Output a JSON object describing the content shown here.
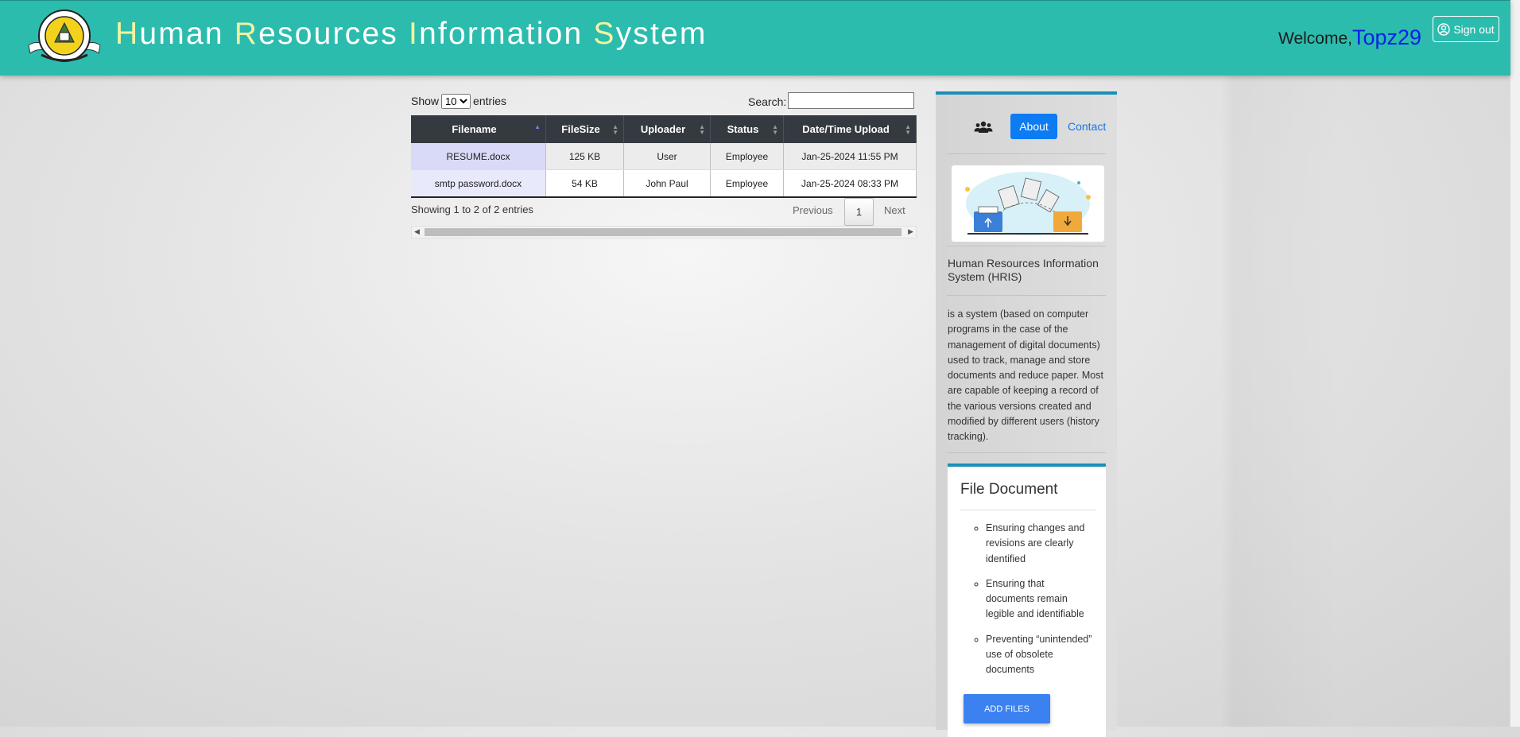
{
  "header": {
    "title_parts": [
      {
        "cap": "H",
        "rest": "uman "
      },
      {
        "cap": "R",
        "rest": "esources "
      },
      {
        "cap": "I",
        "rest": "nformation "
      },
      {
        "cap": "S",
        "rest": "ystem"
      }
    ],
    "welcome": "Welcome,",
    "username": "Topz29",
    "sign_out": "Sign out"
  },
  "table_controls": {
    "show_label": "Show",
    "entries_label": "entries",
    "page_length": "10",
    "search_label": "Search:",
    "search_value": ""
  },
  "table": {
    "columns": [
      "Filename",
      "FileSize",
      "Uploader",
      "Status",
      "Date/Time Upload"
    ],
    "rows": [
      [
        "RESUME.docx",
        "125 KB",
        "User",
        "Employee",
        "Jan-25-2024 11:55 PM"
      ],
      [
        "smtp password.docx",
        "54 KB",
        "John Paul",
        "Employee",
        "Jan-25-2024 08:33 PM"
      ]
    ]
  },
  "pagination": {
    "info": "Showing 1 to 2 of 2 entries",
    "previous": "Previous",
    "current": "1",
    "next": "Next"
  },
  "sidebar": {
    "tabs": {
      "about": "About",
      "contact": "Contact"
    },
    "about_title": "Human Resources Information System (HRIS)",
    "about_text": "is a system (based on computer programs in the case of the management of digital documents) used to track, manage and store documents and reduce paper. Most are capable of keeping a record of the various versions created and modified by different users (history tracking).",
    "card": {
      "title": "File Document",
      "items": [
        "Ensuring changes and revisions are clearly identified",
        "Ensuring that documents remain legible and identifiable",
        "Preventing “unintended” use of obsolete documents"
      ],
      "button": "ADD FILES"
    }
  },
  "colors": {
    "header_bg": "#2bbcae",
    "accent_blue": "#0d7bf2",
    "username": "#0a23e6",
    "table_header": "#343a40"
  }
}
